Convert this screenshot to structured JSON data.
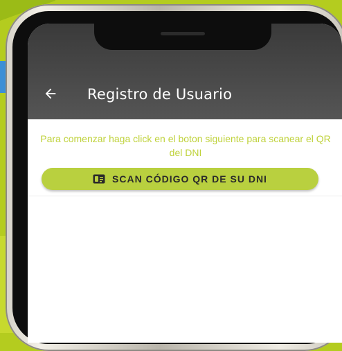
{
  "app": {
    "title": "Registro de Usuario"
  },
  "header": {
    "back_icon": "arrow-left-icon"
  },
  "main": {
    "instructions": "Para comenzar haga click en el boton siguiente para scanear el QR del DNI",
    "scan_button_label": "SCAN CÓDIGO QR DE SU DNI",
    "scan_icon": "id-card-icon"
  },
  "colors": {
    "background": "#b4cc1f",
    "appbar": "#4a4a4a",
    "accent": "#b9d03f",
    "instruction_text": "#bfd23a"
  }
}
